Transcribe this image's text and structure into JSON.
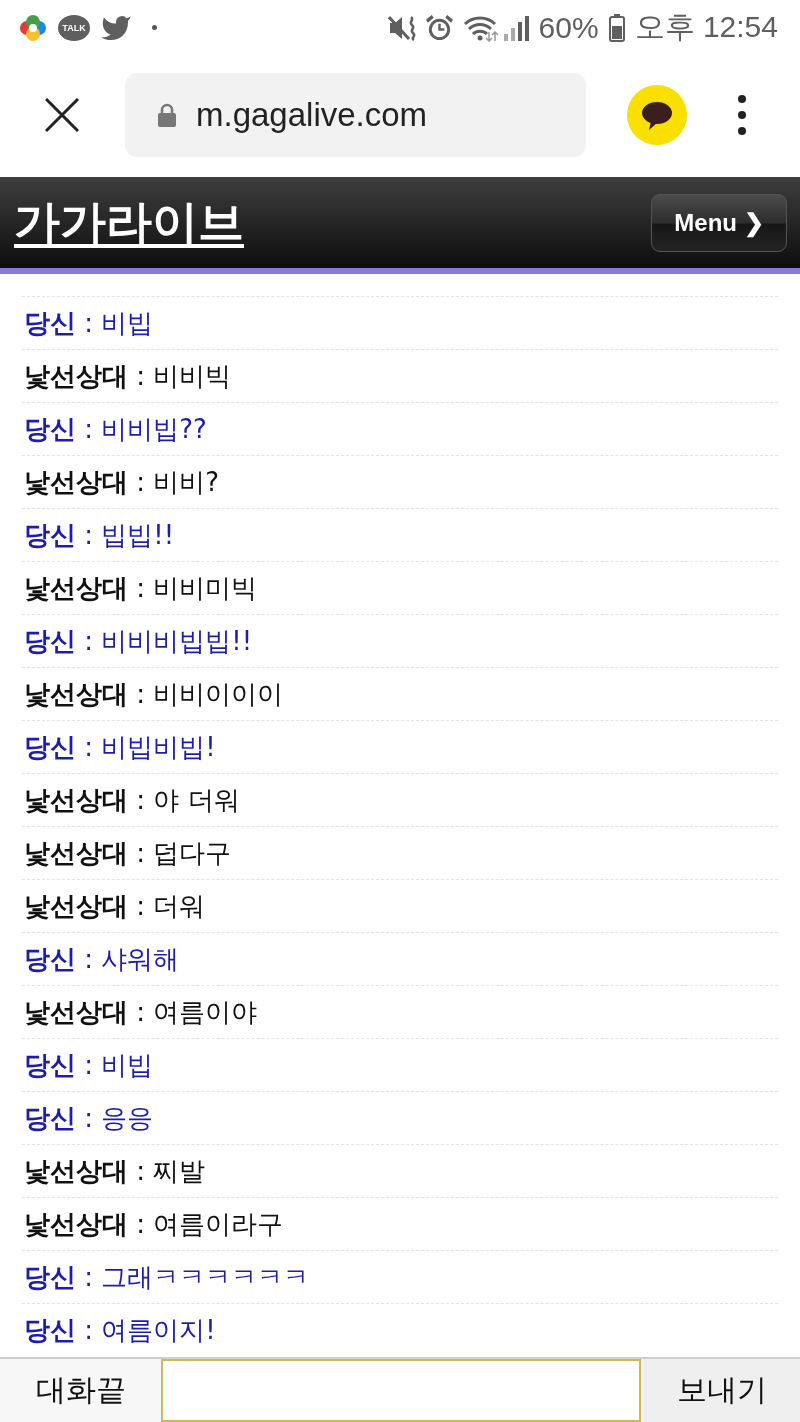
{
  "status_bar": {
    "talk_badge": "TALK",
    "battery": "60%",
    "time": "오후 12:54"
  },
  "browser": {
    "url": "m.gagalive.com"
  },
  "header": {
    "title": "가가라이브",
    "menu_button": "Menu ❯"
  },
  "messages": [
    {
      "kind": "you",
      "text": "**당신** : 비빕"
    },
    {
      "kind": "stranger",
      "text": "**낯선상대** : 비비빅"
    },
    {
      "kind": "you",
      "text": "**당신** : 비비빕??"
    },
    {
      "kind": "stranger",
      "text": "**낯선상대** : 비비?"
    },
    {
      "kind": "you",
      "text": "**당신** : 빕빕!!"
    },
    {
      "kind": "stranger",
      "text": "**낯선상대** : 비비미빅"
    },
    {
      "kind": "you",
      "text": "**당신** : 비비비빕빕!!"
    },
    {
      "kind": "stranger",
      "text": "**낯선상대** : 비비이이이"
    },
    {
      "kind": "you",
      "text": "**당신** : 비빕비빕!"
    },
    {
      "kind": "stranger",
      "text": "**낯선상대** : 야 더워"
    },
    {
      "kind": "stranger",
      "text": "**낯선상대** : 덥다구"
    },
    {
      "kind": "stranger",
      "text": "**낯선상대** : 더워"
    },
    {
      "kind": "you",
      "text": "**당신** : 샤워해"
    },
    {
      "kind": "stranger",
      "text": "**낯선상대** : 여름이야"
    },
    {
      "kind": "you",
      "text": "**당신** : 비빕"
    },
    {
      "kind": "you",
      "text": "**당신** : 응응"
    },
    {
      "kind": "stranger",
      "text": "**낯선상대** : 찌발"
    },
    {
      "kind": "stranger",
      "text": "**낯선상대** : 여름이라구"
    },
    {
      "kind": "you",
      "text": "**당신** : 그래ㅋㅋㅋㅋㅋㅋ"
    },
    {
      "kind": "you",
      "text": "**당신** : 여름이지!"
    }
  ],
  "composer": {
    "end_button": "대화끝",
    "send_button": "보내기"
  }
}
